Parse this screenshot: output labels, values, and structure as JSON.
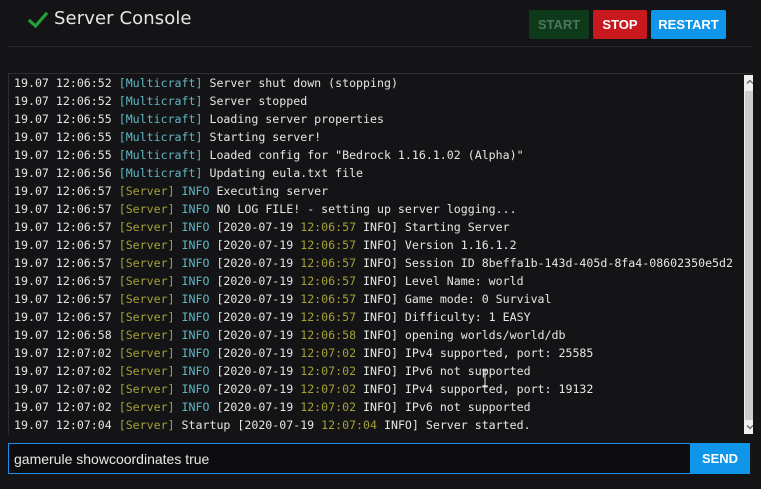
{
  "header": {
    "title": "Server Console",
    "start_label": "START",
    "stop_label": "STOP",
    "restart_label": "RESTART",
    "status_icon": "check-icon",
    "colors": {
      "status_ok": "#21a03a",
      "start": "#0c3a1a",
      "stop": "#c8191f",
      "restart": "#0f95ea"
    }
  },
  "console": {
    "lines": [
      {
        "ts": "19.07 12:06:52",
        "src": "[Multicraft]",
        "kind": "m",
        "level": "",
        "msg": "Server shut down (stopping)"
      },
      {
        "ts": "19.07 12:06:52",
        "src": "[Multicraft]",
        "kind": "m",
        "level": "",
        "msg": "Server stopped"
      },
      {
        "ts": "19.07 12:06:55",
        "src": "[Multicraft]",
        "kind": "m",
        "level": "",
        "msg": "Loading server properties"
      },
      {
        "ts": "19.07 12:06:55",
        "src": "[Multicraft]",
        "kind": "m",
        "level": "",
        "msg": "Starting server!"
      },
      {
        "ts": "19.07 12:06:55",
        "src": "[Multicraft]",
        "kind": "m",
        "level": "",
        "msg": "Loaded config for \"Bedrock 1.16.1.02 (Alpha)\""
      },
      {
        "ts": "19.07 12:06:56",
        "src": "[Multicraft]",
        "kind": "m",
        "level": "",
        "msg": "Updating eula.txt file"
      },
      {
        "ts": "19.07 12:06:57",
        "src": "[Server]",
        "kind": "s",
        "level": "INFO",
        "msg": "Executing server"
      },
      {
        "ts": "19.07 12:06:57",
        "src": "[Server]",
        "kind": "s",
        "level": "INFO",
        "msg": "NO LOG FILE! - setting up server logging..."
      },
      {
        "ts": "19.07 12:06:57",
        "src": "[Server]",
        "kind": "s",
        "level": "INFO",
        "pre": "[2020-07-19 ",
        "time": "12:06:57",
        "post": " INFO] Starting Server"
      },
      {
        "ts": "19.07 12:06:57",
        "src": "[Server]",
        "kind": "s",
        "level": "INFO",
        "pre": "[2020-07-19 ",
        "time": "12:06:57",
        "post": " INFO] Version 1.16.1.2"
      },
      {
        "ts": "19.07 12:06:57",
        "src": "[Server]",
        "kind": "s",
        "level": "INFO",
        "pre": "[2020-07-19 ",
        "time": "12:06:57",
        "post": " INFO] Session ID 8beffa1b-143d-405d-8fa4-08602350e5d2"
      },
      {
        "ts": "19.07 12:06:57",
        "src": "[Server]",
        "kind": "s",
        "level": "INFO",
        "pre": "[2020-07-19 ",
        "time": "12:06:57",
        "post": " INFO] Level Name: world"
      },
      {
        "ts": "19.07 12:06:57",
        "src": "[Server]",
        "kind": "s",
        "level": "INFO",
        "pre": "[2020-07-19 ",
        "time": "12:06:57",
        "post": " INFO] Game mode: 0 Survival"
      },
      {
        "ts": "19.07 12:06:57",
        "src": "[Server]",
        "kind": "s",
        "level": "INFO",
        "pre": "[2020-07-19 ",
        "time": "12:06:57",
        "post": " INFO] Difficulty: 1 EASY"
      },
      {
        "ts": "19.07 12:06:58",
        "src": "[Server]",
        "kind": "s",
        "level": "INFO",
        "pre": "[2020-07-19 ",
        "time": "12:06:58",
        "post": " INFO] opening worlds/world/db"
      },
      {
        "ts": "19.07 12:07:02",
        "src": "[Server]",
        "kind": "s",
        "level": "INFO",
        "pre": "[2020-07-19 ",
        "time": "12:07:02",
        "post": " INFO] IPv4 supported, port: 25585"
      },
      {
        "ts": "19.07 12:07:02",
        "src": "[Server]",
        "kind": "s",
        "level": "INFO",
        "pre": "[2020-07-19 ",
        "time": "12:07:02",
        "post": " INFO] IPv6 not supported"
      },
      {
        "ts": "19.07 12:07:02",
        "src": "[Server]",
        "kind": "s",
        "level": "INFO",
        "pre": "[2020-07-19 ",
        "time": "12:07:02",
        "post": " INFO] IPv4 supported, port: 19132"
      },
      {
        "ts": "19.07 12:07:02",
        "src": "[Server]",
        "kind": "s",
        "level": "INFO",
        "pre": "[2020-07-19 ",
        "time": "12:07:02",
        "post": " INFO] IPv6 not supported"
      },
      {
        "ts": "19.07 12:07:04",
        "src": "[Server]",
        "kind": "s",
        "level": "",
        "pre": "Startup [2020-07-19 ",
        "time": "12:07:04",
        "post": " INFO] Server started."
      }
    ]
  },
  "command": {
    "value": "gamerule showcoordinates true",
    "send_label": "SEND"
  }
}
